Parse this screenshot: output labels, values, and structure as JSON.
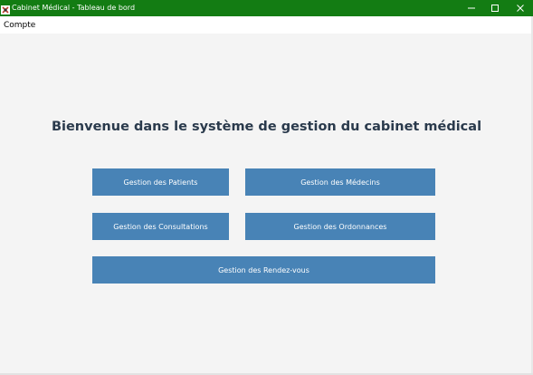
{
  "window": {
    "title": "Cabinet Médical - Tableau de bord",
    "icon": "app-icon",
    "title_bar_color": "#137c13",
    "controls": [
      "minimize-icon",
      "maximize-icon",
      "close-icon"
    ]
  },
  "menu": {
    "items": [
      {
        "label": "Compte"
      }
    ]
  },
  "main": {
    "heading": "Bienvenue dans le système de gestion du cabinet médical",
    "button_color": "#4883b6",
    "buttons": {
      "patients": "Gestion des Patients",
      "medecins": "Gestion des Médecins",
      "consultations": "Gestion des Consultations",
      "ordonnances": "Gestion des Ordonnances",
      "rendezvous": "Gestion des Rendez-vous"
    }
  }
}
